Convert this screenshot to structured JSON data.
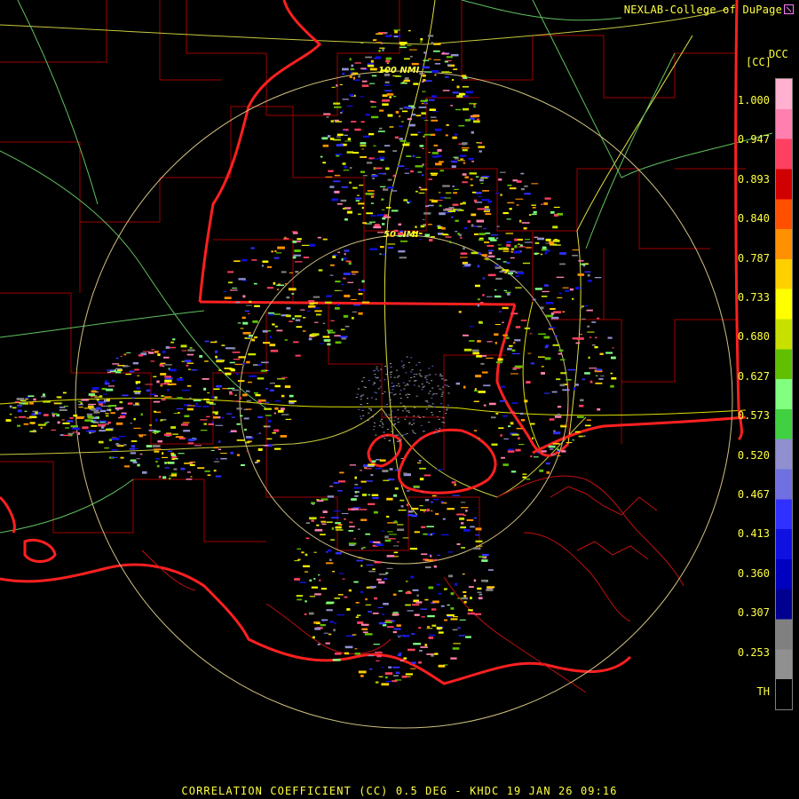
{
  "credit": "NEXLAB-College of DuPage",
  "legend": {
    "product": "DCC",
    "unit": "[CC]",
    "ticks": [
      "1.000",
      "0.947",
      "0.893",
      "0.840",
      "0.787",
      "0.733",
      "0.680",
      "0.627",
      "0.573",
      "0.520",
      "0.467",
      "0.413",
      "0.360",
      "0.307",
      "0.253",
      "TH"
    ],
    "colors": [
      "#ffb0d0",
      "#ff80b0",
      "#ff4060",
      "#d00000",
      "#ff5000",
      "#ff9000",
      "#ffd000",
      "#ffff00",
      "#c8e000",
      "#60c000",
      "#80ff80",
      "#40d040",
      "#9090d0",
      "#7070e0",
      "#3030ff",
      "#1010e0",
      "#0000c0",
      "#000090",
      "#808080",
      "#909090",
      "#000000"
    ]
  },
  "range_rings": {
    "inner": "50 NMI",
    "outer": "100 NMI"
  },
  "footer": "CORRELATION COEFFICIENT (CC) 0.5 DEG - KHDC 19 JAN 26 09:16",
  "icons": {
    "credit_logo": "external-link-icon"
  }
}
